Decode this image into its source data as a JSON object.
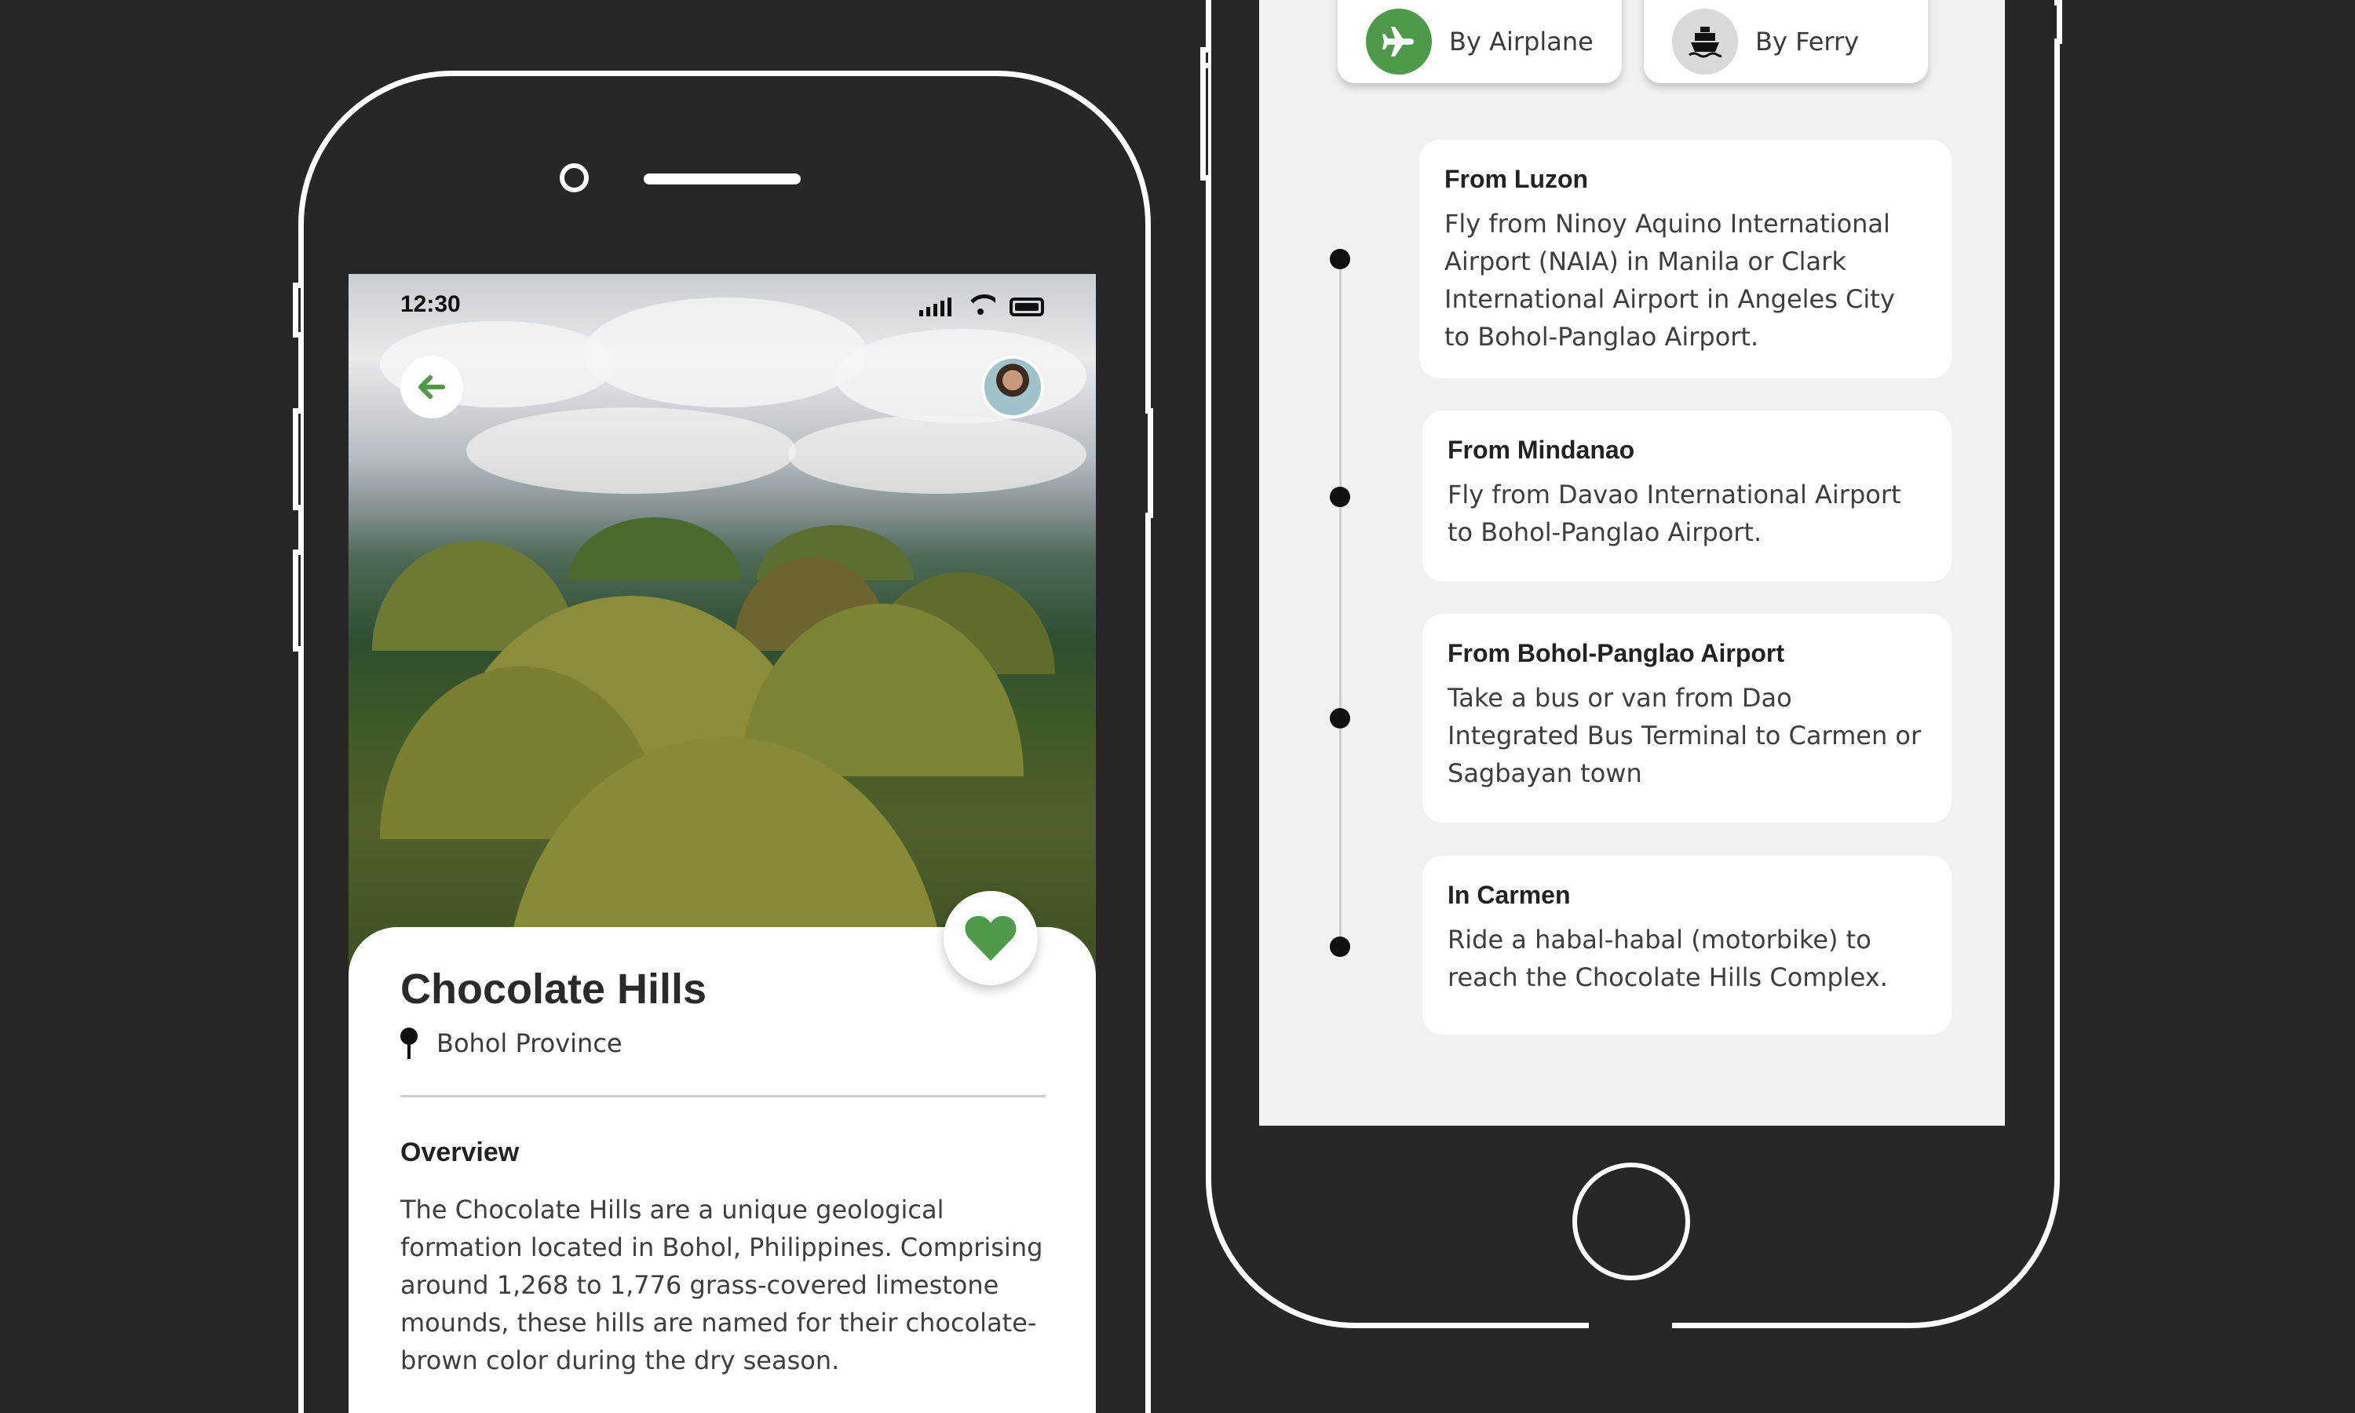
{
  "left_phone": {
    "status": {
      "time": "12:30"
    },
    "destination": {
      "title": "Chocolate Hills",
      "location": "Bohol Province",
      "overview_heading": "Overview",
      "overview_text": "The Chocolate Hills are a unique geological formation located in Bohol, Philippines. Comprising around 1,268 to 1,776 grass-covered limestone mounds, these hills are named for their chocolate-brown color during the dry season."
    },
    "icons": {
      "back": "arrow-left-icon",
      "favorite": "heart-icon",
      "location": "map-pin-icon"
    },
    "colors": {
      "accent": "#4f9a4a"
    }
  },
  "right_phone": {
    "tabs": [
      {
        "label": "By Airplane",
        "icon": "airplane-icon",
        "active": true
      },
      {
        "label": "By Ferry",
        "icon": "ferry-icon",
        "active": false
      }
    ],
    "steps": [
      {
        "title": "From Luzon",
        "text": "Fly from Ninoy Aquino International Airport (NAIA) in Manila or Clark International Airport in Angeles City to Bohol-Panglao Airport."
      },
      {
        "title": "From Mindanao",
        "text": "Fly from Davao International Airport to Bohol-Panglao Airport."
      },
      {
        "title": "From Bohol-Panglao Airport",
        "text": "Take a bus or van from Dao Integrated Bus Terminal to Carmen or Sagbayan town"
      },
      {
        "title": "In Carmen",
        "text": "Ride a habal-habal (motorbike) to reach the Chocolate Hills Complex."
      }
    ]
  }
}
